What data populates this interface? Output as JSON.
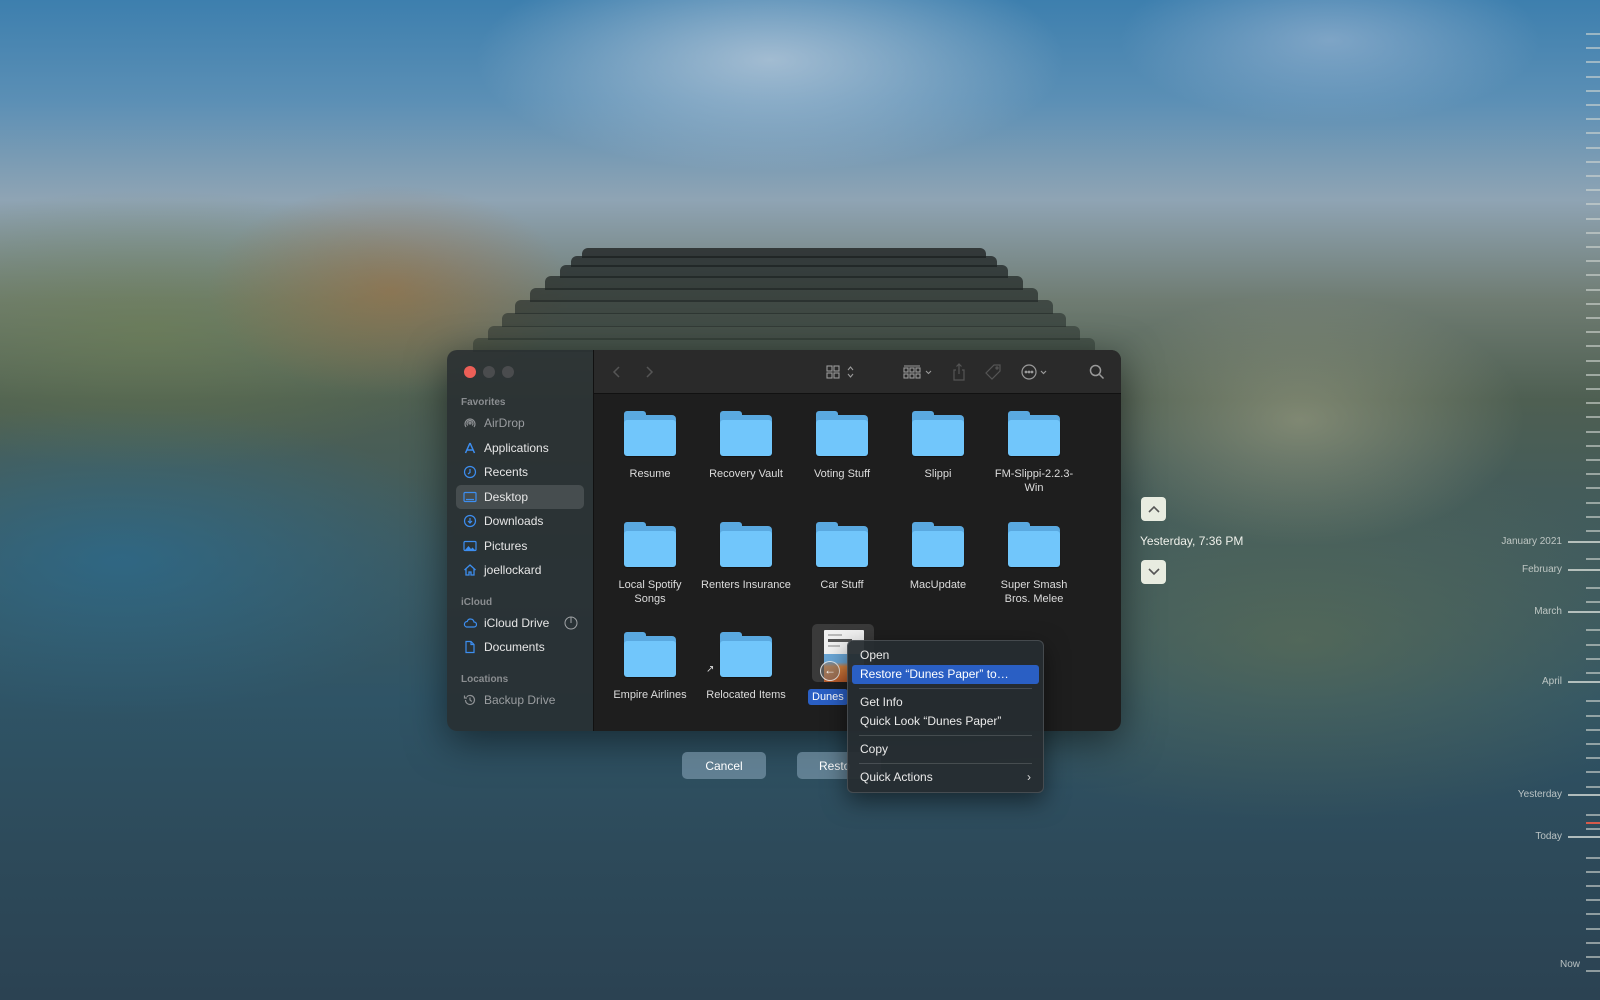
{
  "window": {
    "traffic_lights": [
      "close",
      "minimize",
      "maximize"
    ]
  },
  "sidebar": {
    "sections": [
      {
        "title": "Favorites"
      },
      {
        "title": "iCloud"
      },
      {
        "title": "Locations"
      }
    ],
    "items": [
      {
        "label": "AirDrop",
        "icon": "airdrop-icon",
        "dim": true
      },
      {
        "label": "Applications",
        "icon": "applications-icon"
      },
      {
        "label": "Recents",
        "icon": "clock-icon"
      },
      {
        "label": "Desktop",
        "icon": "desktop-icon",
        "active": true
      },
      {
        "label": "Downloads",
        "icon": "download-icon"
      },
      {
        "label": "Pictures",
        "icon": "pictures-icon"
      },
      {
        "label": "joellockard",
        "icon": "home-icon"
      },
      {
        "label": "iCloud Drive",
        "icon": "cloud-icon",
        "extra_icon": "sync-progress-icon"
      },
      {
        "label": "Documents",
        "icon": "document-icon"
      },
      {
        "label": "Backup Drive",
        "icon": "time-machine-icon",
        "dim": true
      }
    ]
  },
  "toolbar": {
    "back": "chevron-left-icon",
    "forward": "chevron-right-icon",
    "view_mode": "icon-view-icon",
    "group": "group-by-icon",
    "share": "share-icon",
    "tag": "tag-icon",
    "more": "ellipsis-circle-icon",
    "search": "search-icon"
  },
  "files": [
    {
      "name": "Resume",
      "type": "folder"
    },
    {
      "name": "Recovery Vault",
      "type": "folder"
    },
    {
      "name": "Voting Stuff",
      "type": "folder"
    },
    {
      "name": "Slippi",
      "type": "folder"
    },
    {
      "name": "FM-Slippi-2.2.3-Win",
      "type": "folder"
    },
    {
      "name": "Local Spotify Songs",
      "type": "folder"
    },
    {
      "name": "Renters Insurance",
      "type": "folder"
    },
    {
      "name": "Car Stuff",
      "type": "folder"
    },
    {
      "name": "MacUpdate",
      "type": "folder"
    },
    {
      "name": "Super Smash Bros. Melee",
      "type": "folder"
    },
    {
      "name": "Empire Airlines",
      "type": "folder"
    },
    {
      "name": "Relocated Items",
      "type": "folder",
      "alias": true
    },
    {
      "name": "Dunes",
      "type": "document",
      "selected": true
    }
  ],
  "doc_thumb": {
    "title": "Desert Dunes"
  },
  "buttons": {
    "cancel": "Cancel",
    "restore": "Resto"
  },
  "context_menu": {
    "items": [
      {
        "label": "Open"
      },
      {
        "label": "Restore “Dunes Paper” to…",
        "highlighted": true
      },
      {
        "separator": true
      },
      {
        "label": "Get Info"
      },
      {
        "label": "Quick Look “Dunes Paper”"
      },
      {
        "separator": true
      },
      {
        "label": "Copy"
      },
      {
        "separator": true
      },
      {
        "label": "Quick Actions",
        "submenu": true
      }
    ]
  },
  "time_machine": {
    "current_snapshot": "Yesterday, 7:36 PM",
    "up": "chevron-up-icon",
    "down": "chevron-down-icon"
  },
  "timeline": {
    "labels": [
      "January 2021",
      "February",
      "March",
      "April",
      "Yesterday",
      "Today",
      "Now"
    ]
  }
}
